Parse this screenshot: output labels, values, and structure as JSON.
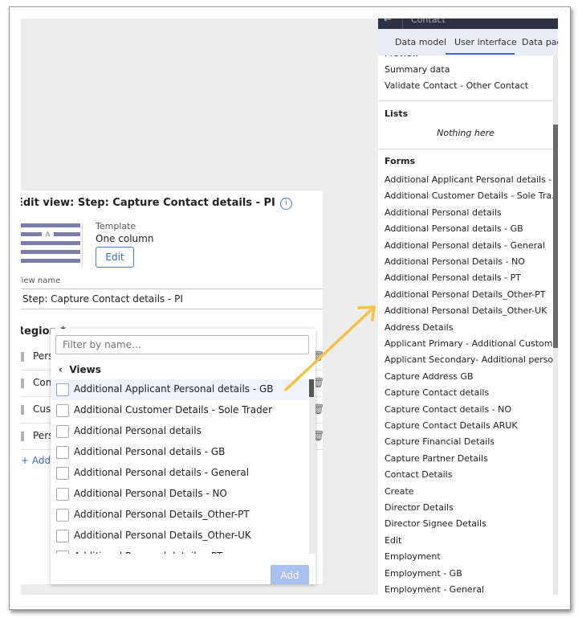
{
  "edit_view": {
    "title": "Edit view: Step: Capture Contact details - PI",
    "info_icon": "info-circle-icon",
    "template_label": "Template",
    "template_value": "One column",
    "template_badge": "A",
    "edit_button": "Edit",
    "view_name_label": "View name",
    "view_name_value": "Step: Capture Contact details - PI",
    "region_label": "Region",
    "region_rows": [
      "Pers",
      "Con",
      "Cust",
      "Pers"
    ],
    "add_link": "+ Add"
  },
  "popover": {
    "filter_placeholder": "Filter by name...",
    "back_icon": "chevron-left-icon",
    "views_header": "Views",
    "options": [
      "Additional Applicant Personal details - GB",
      "Additional Customer Details - Sole Trader",
      "Additional Personal details",
      "Additional Personal details - GB",
      "Additional Personal details - General",
      "Additional Personal Details - NO",
      "Additional Personal Details_Other-PT",
      "Additional Personal Details_Other-UK",
      "Additional Personal details - PT"
    ],
    "highlighted_index": 0,
    "add_button": "Add"
  },
  "right_panel": {
    "title": "Contact",
    "tabs": [
      "Data model",
      "User interface",
      "Data page"
    ],
    "active_tab": "User interface",
    "top_cut_item": "Preview",
    "top_items": [
      "Summary data",
      "Validate Contact - Other Contact"
    ],
    "lists_header": "Lists",
    "lists_empty": "Nothing here",
    "forms_header": "Forms",
    "forms": [
      "Additional Applicant Personal details - ...",
      "Additional Customer Details - Sole Tra...",
      "Additional Personal details",
      "Additional Personal details - GB",
      "Additional Personal details - General",
      "Additional Personal Details - NO",
      "Additional Personal details - PT",
      "Additional Personal Details_Other-PT",
      "Additional Personal Details_Other-UK",
      "Address Details",
      "Applicant Primary - Additional Custom...",
      "Applicant Secondary- Additional perso...",
      "Capture Address GB",
      "Capture Contact details",
      "Capture Contact details - NO",
      "Capture Contact Details ARUK",
      "Capture Financial Details",
      "Capture Partner Details",
      "Contact Details",
      "Create",
      "Director Details",
      "Director Signee Details",
      "Edit",
      "Employment",
      "Employment - GB",
      "Employment - General"
    ]
  },
  "annotation": {
    "arrow_color": "#f5c242"
  }
}
